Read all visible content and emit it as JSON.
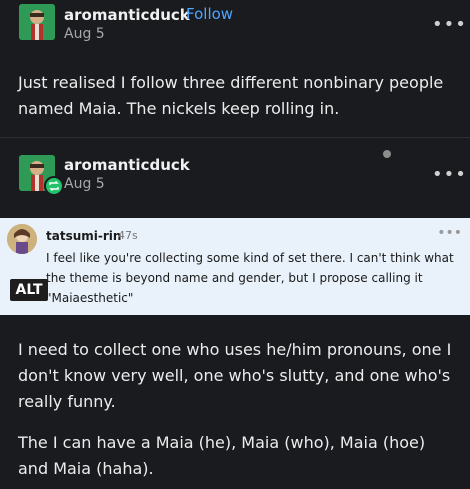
{
  "original_post": {
    "username": "aromanticduck",
    "follow_label": "Follow",
    "date": "Aug 5",
    "more_icon": "more-dots-icon",
    "text": "Just realised I follow three different nonbinary people named Maia. The nickels keep rolling in."
  },
  "reblog": {
    "username": "aromanticduck",
    "date": "Aug 5",
    "badge_icon": "reblog-icon",
    "more_icon": "more-dots-icon"
  },
  "screenshot_quote": {
    "username": "tatsumi-rin",
    "time": "47s",
    "text": "I feel like you're collecting some kind of set there. I can't think what the theme is beyond name and gender, but I propose calling it \"Maiaesthetic\"",
    "alt_label": "ALT"
  },
  "reply": {
    "paragraph_1": "I need to collect one who uses he/him pronouns, one I don't know very well, one who's slutty, and one who's really funny.",
    "paragraph_2": "The I can have a Maia (he), Maia (who), Maia (hoe) and Maia (haha)."
  },
  "colors": {
    "background": "#191b1f",
    "follow_blue": "#4ea6ff",
    "reblog_green": "#23c26b",
    "quote_bg": "#e9f2fb"
  }
}
